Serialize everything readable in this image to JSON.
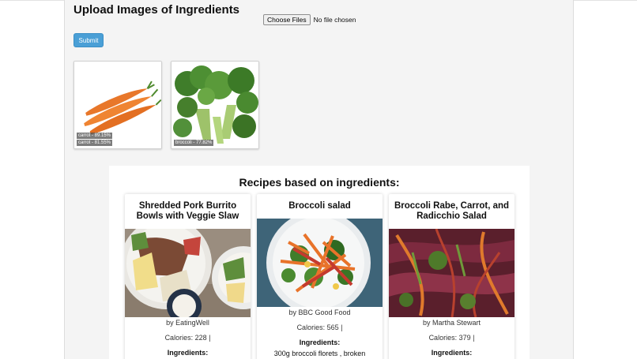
{
  "upload": {
    "title": "Upload Images of Ingredients",
    "choose_label": "Choose Files",
    "file_status": "No file chosen",
    "submit_label": "Submit"
  },
  "images": [
    {
      "name": "carrot",
      "predictions": [
        "carrot - 89.15%",
        "carrot - 81.55%"
      ]
    },
    {
      "name": "broccoli",
      "predictions": [
        "broccoli - 77.82%"
      ]
    }
  ],
  "recipes": {
    "heading": "Recipes based on ingredients:",
    "ingredients_label": "Ingredients:",
    "cards": [
      {
        "title": "Shredded Pork Burrito Bowls with Veggie Slaw",
        "source": "by EatingWell",
        "calories": "Calories: 228 |",
        "ingredient": ""
      },
      {
        "title": "Broccoli salad",
        "source": "by BBC Good Food",
        "calories": "Calories: 565 |",
        "ingredient": "300g broccoli florets , broken"
      },
      {
        "title": "Broccoli Rabe, Carrot, and Radicchio Salad",
        "source": "by Martha Stewart",
        "calories": "Calories: 379 |",
        "ingredient": ""
      }
    ]
  }
}
